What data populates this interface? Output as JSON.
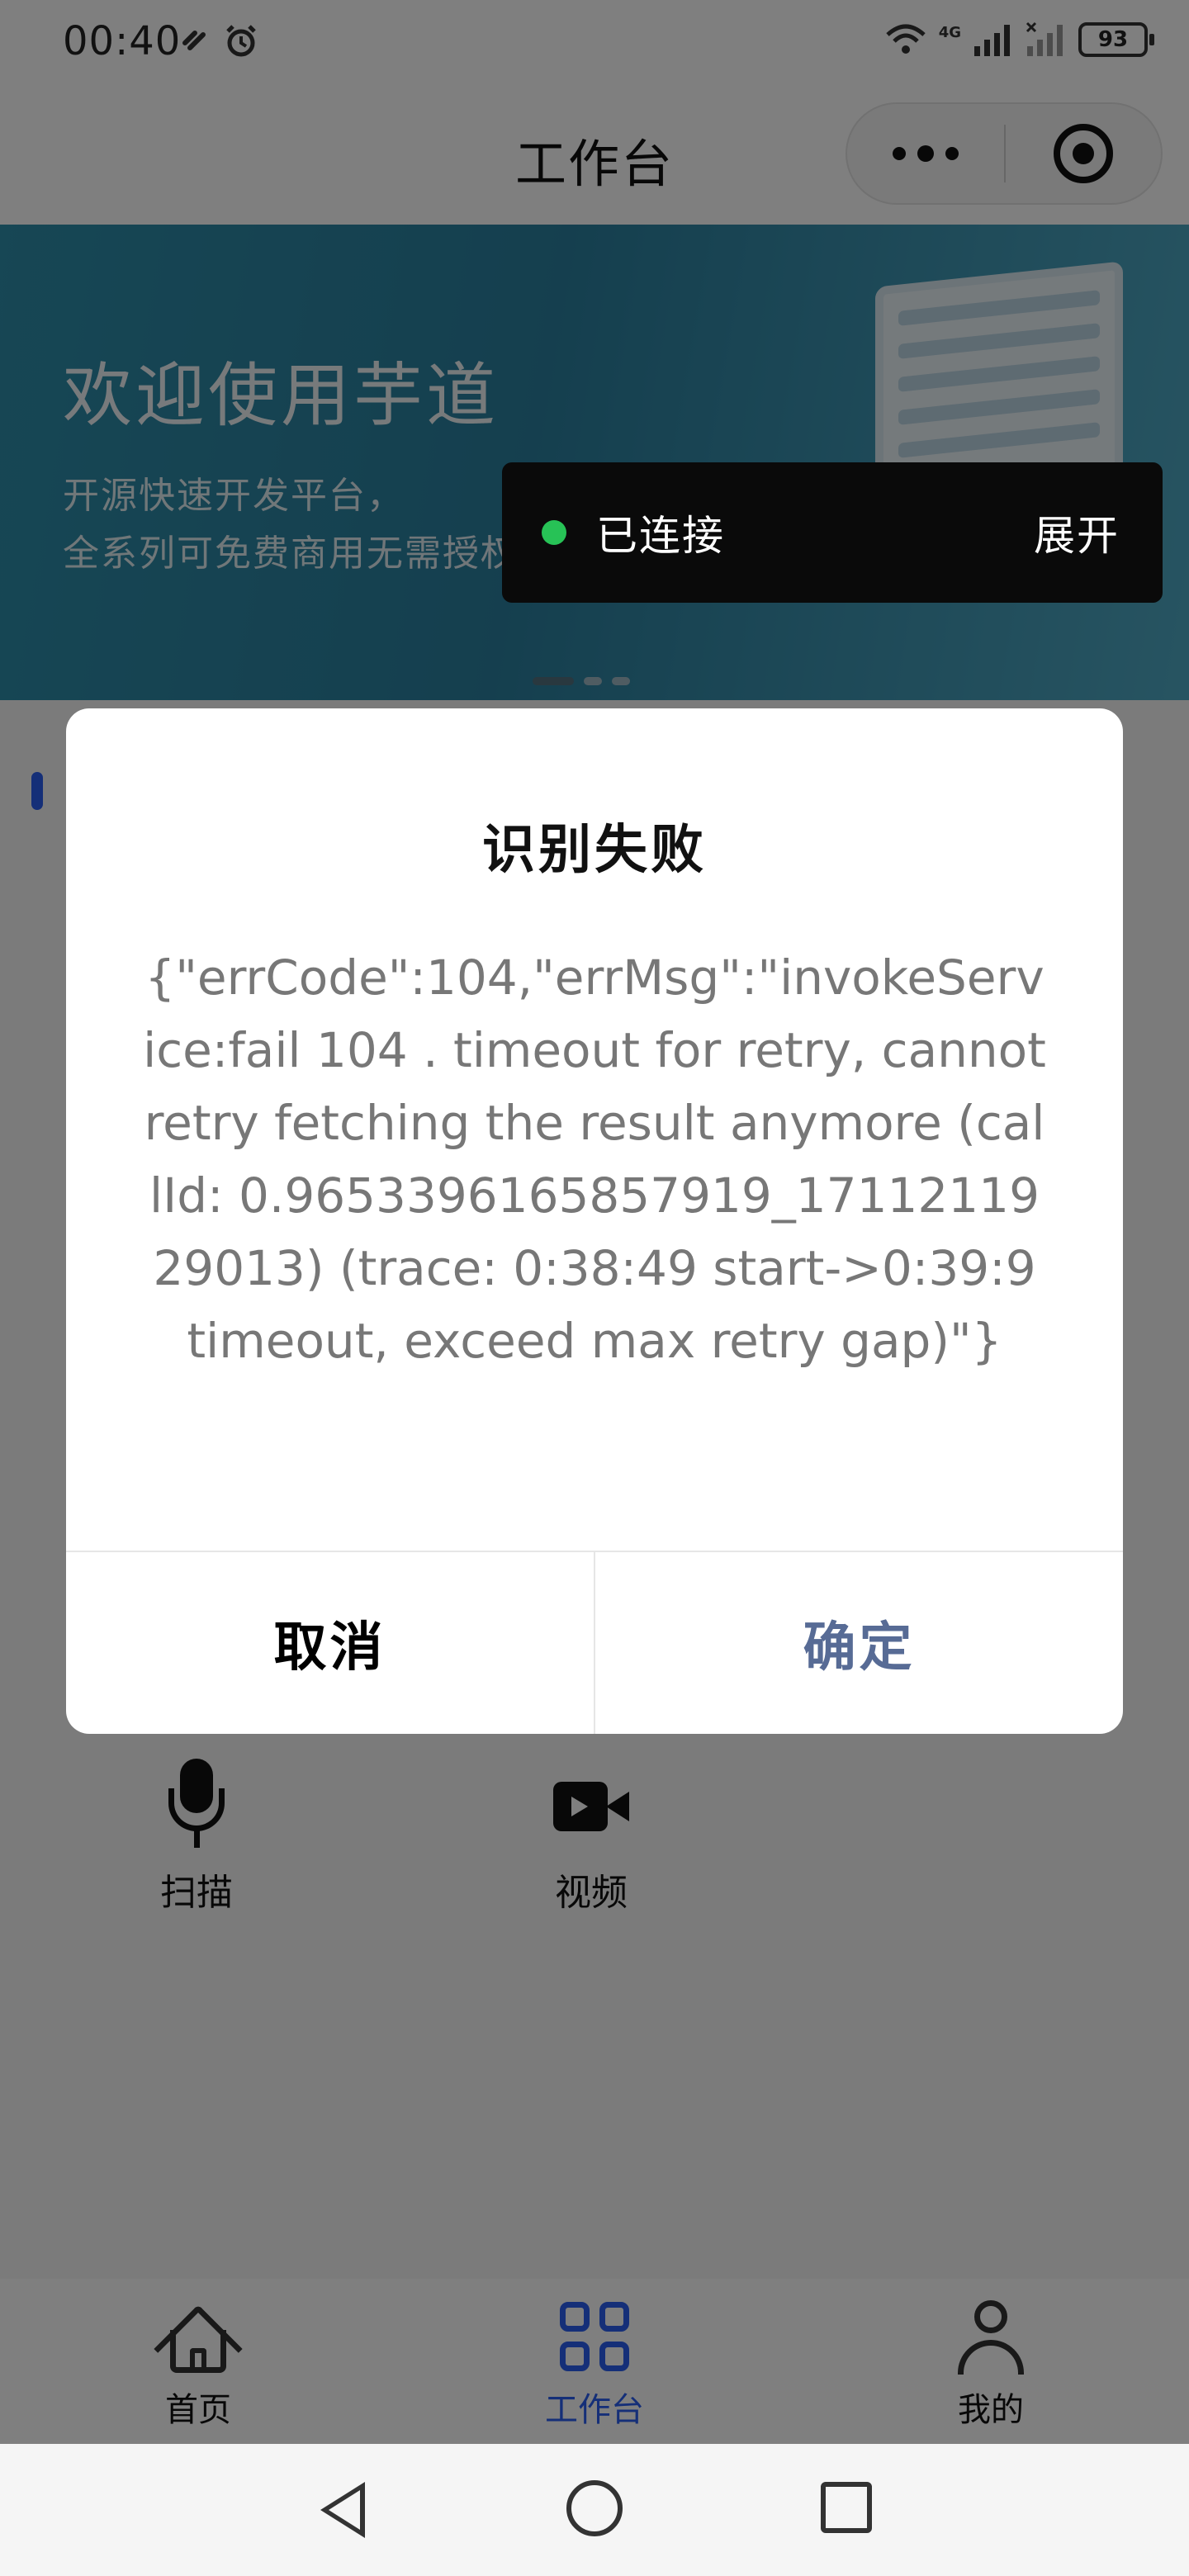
{
  "status_bar": {
    "time": "00:40",
    "network": "4G",
    "battery": "93"
  },
  "nav": {
    "title": "工作台"
  },
  "banner": {
    "title": "欢迎使用芋道",
    "subtitle_line1": "开源快速开发平台，",
    "subtitle_line2": "全系列可免费商用无需授权"
  },
  "connection_toast": {
    "status": "已连接",
    "expand_label": "展开",
    "status_color": "#27c256"
  },
  "modal": {
    "title": "识别失败",
    "content": "{\"errCode\":104,\"errMsg\":\"invokeService:fail 104 . timeout for retry, cannot retry fetching the result anymore (callId: 0.9653396165857919_1711211929013) (trace: 0:38:49 start->0:39:9 timeout, exceed max retry gap)\"}",
    "cancel_label": "取消",
    "confirm_label": "确定",
    "confirm_color": "#576b95"
  },
  "quick_actions": [
    {
      "label": "扫描",
      "icon": "microphone-icon"
    },
    {
      "label": "视频",
      "icon": "video-camera-icon"
    }
  ],
  "tab_bar": {
    "items": [
      {
        "label": "首页",
        "icon": "home-icon",
        "active": false
      },
      {
        "label": "工作台",
        "icon": "grid-icon",
        "active": true
      },
      {
        "label": "我的",
        "icon": "user-icon",
        "active": false
      }
    ],
    "active_color": "#2a5ff0"
  },
  "system_nav": {
    "buttons": [
      "back-icon",
      "home-circle-icon",
      "recents-icon"
    ]
  }
}
